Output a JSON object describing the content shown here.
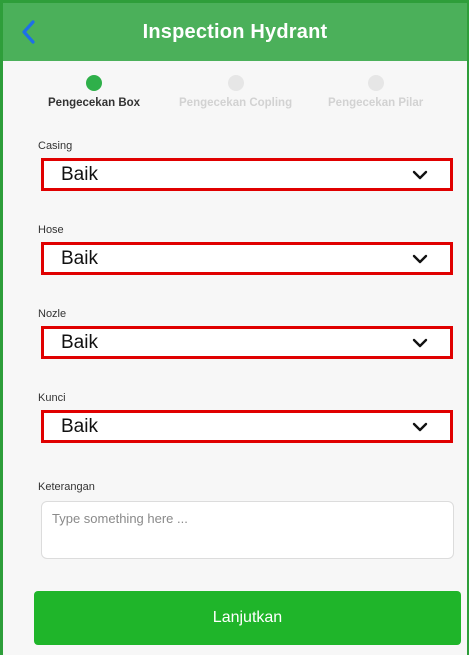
{
  "header": {
    "title": "Inspection Hydrant",
    "back_icon": "chevron-left-icon"
  },
  "stepper": {
    "steps": [
      {
        "label": "Pengecekan Box",
        "state": "active"
      },
      {
        "label": "Pengecekan Copling",
        "state": "inactive"
      },
      {
        "label": "Pengecekan Pilar",
        "state": "inactive"
      }
    ]
  },
  "form": {
    "fields": [
      {
        "label": "Casing",
        "value": "Baik"
      },
      {
        "label": "Hose",
        "value": "Baik"
      },
      {
        "label": "Nozle",
        "value": "Baik"
      },
      {
        "label": "Kunci",
        "value": "Baik"
      }
    ],
    "notes": {
      "label": "Keterangan",
      "placeholder": "Type something here ..."
    },
    "submit_label": "Lanjutkan"
  },
  "colors": {
    "header": "#4bb05a",
    "accent": "#1fb52a",
    "highlight_border": "#e00000"
  }
}
